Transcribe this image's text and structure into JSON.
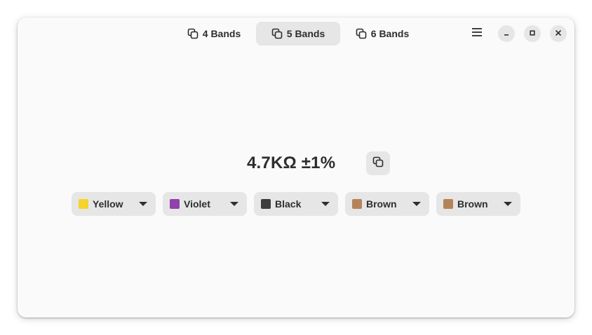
{
  "tabs": [
    {
      "label": "4 Bands",
      "active": false,
      "icon": "copy-icon"
    },
    {
      "label": "5 Bands",
      "active": true,
      "icon": "copy-icon"
    },
    {
      "label": "6 Bands",
      "active": false,
      "icon": "copy-icon"
    }
  ],
  "window_controls": {
    "menu_icon": "hamburger-menu-icon",
    "minimize_icon": "minimize-icon",
    "maximize_icon": "maximize-icon",
    "close_icon": "close-icon"
  },
  "result": {
    "value": "4.7KΩ ±1%",
    "copy_icon": "copy-icon"
  },
  "bands": [
    {
      "label": "Yellow",
      "swatch": "#f6d32d"
    },
    {
      "label": "Violet",
      "swatch": "#9141ac"
    },
    {
      "label": "Black",
      "swatch": "#3d3d3d"
    },
    {
      "label": "Brown",
      "swatch": "#b5835a"
    },
    {
      "label": "Brown",
      "swatch": "#b5835a"
    }
  ],
  "colors": {
    "window_bg": "#fafafa",
    "button_bg": "#e6e6e6",
    "text": "#2e2e2e"
  }
}
